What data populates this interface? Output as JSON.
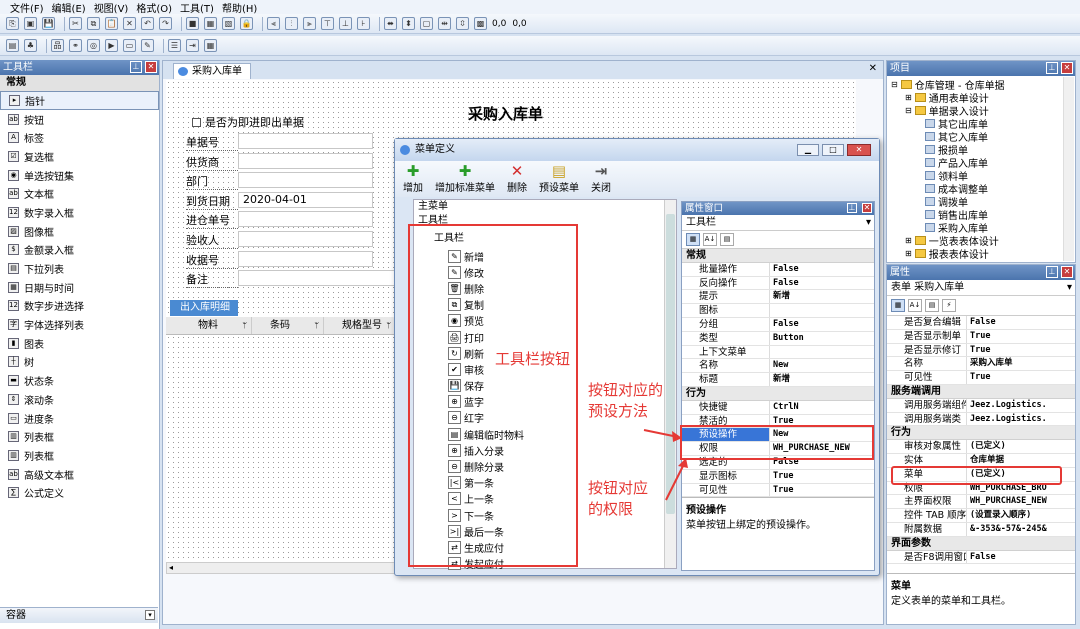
{
  "menu": [
    "文件(F)",
    "编辑(E)",
    "视图(V)",
    "格式(O)",
    "工具(T)",
    "帮助(H)"
  ],
  "toolbar1_icons": [
    "new-icon",
    "open-icon",
    "save-icon",
    "cut-icon",
    "copy-icon",
    "paste-icon",
    "delete-icon",
    "undo-icon",
    "redo-icon",
    "stop-icon",
    "grid-icon",
    "snap-icon",
    "lock-icon",
    "align-left-icon",
    "align-center-icon",
    "align-right-icon",
    "align-top-icon",
    "align-middle-icon",
    "align-bottom-icon",
    "same-width-icon",
    "same-height-icon",
    "same-size-icon",
    "space-h-icon",
    "space-v-icon",
    "grid-size-icon"
  ],
  "toolbar1_texts": [
    "0,0",
    "0,0"
  ],
  "toolbox": {
    "title": "工具栏",
    "group": "常规",
    "items": [
      "指针",
      "按钮",
      "标签",
      "复选框",
      "单选按钮集",
      "文本框",
      "数字录入框",
      "图像框",
      "金额录入框",
      "下拉列表",
      "日期与时间",
      "数字步进选择",
      "字体选择列表",
      "图表",
      "树",
      "状态条",
      "滚动条",
      "进度条",
      "列表框",
      "列表框",
      "高级文本框",
      "公式定义"
    ],
    "footer": "容器"
  },
  "doc_tab": "采购入库单",
  "form": {
    "title": "采购入库单",
    "checkbox_label": "是否为即进即出单据",
    "fields": [
      {
        "label": "单据号",
        "value": ""
      },
      {
        "label": "供货商",
        "value": ""
      },
      {
        "label": "部门",
        "value": ""
      },
      {
        "label": "到货日期",
        "value": "2020-04-01"
      },
      {
        "label": "进仓单号",
        "value": ""
      },
      {
        "label": "验收人",
        "value": ""
      },
      {
        "label": "收据号",
        "value": ""
      },
      {
        "label": "备注",
        "value": ""
      }
    ],
    "detail_tab": "出入库明细",
    "columns": [
      "物料",
      "条码",
      "规格型号"
    ]
  },
  "dialog": {
    "title": "菜单定义",
    "buttons": [
      "增加",
      "增加标准菜单",
      "删除",
      "预设菜单",
      "关闭"
    ],
    "tree_root": "主菜单",
    "tree_toolbar": "工具栏",
    "tree_toolbar2": "工具栏",
    "buttons_list": [
      "新增",
      "修改",
      "删除",
      "复制",
      "预览",
      "打印",
      "刷新",
      "审核",
      "保存",
      "蓝字",
      "红字",
      "编辑临时物料",
      "插入分录",
      "删除分录",
      "第一条",
      "上一条",
      "下一条",
      "最后一条",
      "生成应付",
      "发起应付"
    ],
    "prop_title": "属性窗口",
    "prop_select": "工具栏",
    "props": [
      {
        "cat": "常规"
      },
      {
        "k": "批量操作",
        "v": "False"
      },
      {
        "k": "反向操作",
        "v": "False"
      },
      {
        "k": "提示",
        "v": "新增"
      },
      {
        "k": "图标",
        "v": ""
      },
      {
        "k": "分组",
        "v": "False"
      },
      {
        "k": "类型",
        "v": "Button"
      },
      {
        "k": "上下文菜单",
        "v": ""
      },
      {
        "k": "名称",
        "v": "New"
      },
      {
        "k": "标题",
        "v": "新增"
      },
      {
        "cat": "行为"
      },
      {
        "k": "快捷键",
        "v": "CtrlN"
      },
      {
        "k": "禁活的",
        "v": "True"
      },
      {
        "k": "预设操作",
        "v": "New"
      },
      {
        "k": "权限",
        "v": "WH_PURCHASE_NEW"
      },
      {
        "k": "选定的",
        "v": "False"
      },
      {
        "k": "显示图标",
        "v": "True"
      },
      {
        "k": "可见性",
        "v": "True"
      }
    ],
    "desc_title": "预设操作",
    "desc_text": "菜单按钮上绑定的预设操作。"
  },
  "annotations": [
    "工具栏按钮",
    "按钮对应的预设方法",
    "按钮对应的权限"
  ],
  "project": {
    "title": "项目",
    "root": "仓库管理 - 仓库单据",
    "nodes": [
      "通用表单设计",
      "单据录入设计",
      "其它出库单",
      "其它入库单",
      "报损单",
      "产品入库单",
      "领料单",
      "成本调整单",
      "调拨单",
      "销售出库单",
      "采购入库单",
      "一览表表体设计",
      "报表表体设计"
    ]
  },
  "props_right": {
    "title": "属性",
    "select": "表单  采购入库单",
    "rows": [
      {
        "k": "是否复合编辑",
        "v": "False"
      },
      {
        "k": "是否显示制单",
        "v": "True"
      },
      {
        "k": "是否显示修订",
        "v": "True"
      },
      {
        "k": "名称",
        "v": "采购入库单"
      },
      {
        "k": "可见性",
        "v": "True"
      },
      {
        "cat": "服务端调用"
      },
      {
        "k": "调用服务端组件",
        "v": "Jeez.Logistics."
      },
      {
        "k": "调用服务端类",
        "v": "Jeez.Logistics."
      },
      {
        "cat": "行为"
      },
      {
        "k": "审核对象属性",
        "v": "(已定义)"
      },
      {
        "k": "实体",
        "v": "仓库单据"
      },
      {
        "k": "菜单",
        "v": "(已定义)"
      },
      {
        "k": "权限",
        "v": "WH_PURCHASE_BRO"
      },
      {
        "k": "主界面权限",
        "v": "WH_PURCHASE_NEW"
      },
      {
        "k": "控件 TAB 顺序",
        "v": "(设置录入顺序)"
      },
      {
        "k": "附属数据",
        "v": "&-353&-57&-245&"
      },
      {
        "cat": "界面参数"
      },
      {
        "k": "是否F8调用窗口",
        "v": "False"
      }
    ],
    "desc_title": "菜单",
    "desc_text": "定义表单的菜单和工具栏。"
  }
}
